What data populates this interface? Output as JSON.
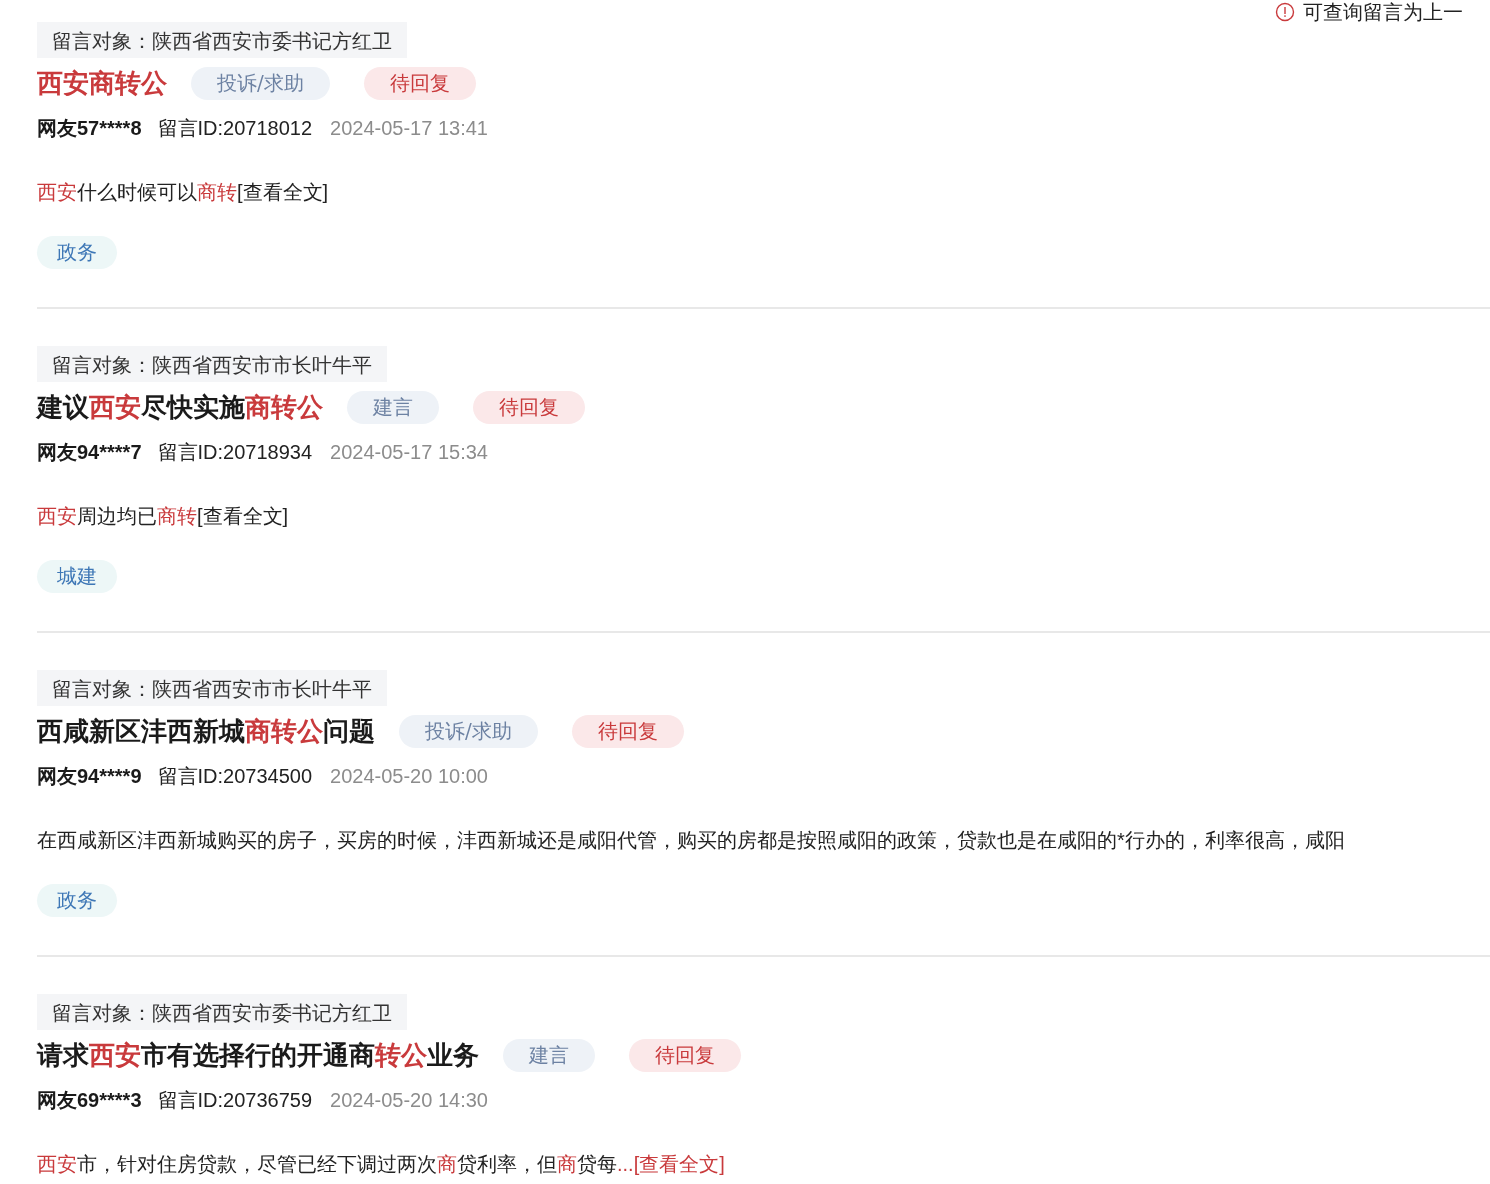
{
  "notice": {
    "text": "可查询留言为上一"
  },
  "messages": [
    {
      "target": "留言对象：陕西省西安市委书记方红卫",
      "title": [
        {
          "text": "西安商转公",
          "highlight": true
        }
      ],
      "type": "投诉/求助",
      "status": "待回复",
      "author": "网友57****8",
      "message_id": "留言ID:20718012",
      "time": "2024-05-17 13:41",
      "excerpt": [
        {
          "text": "西安",
          "highlight": true
        },
        {
          "text": "什么时候可以",
          "highlight": false
        },
        {
          "text": "商转",
          "highlight": true
        }
      ],
      "more": {
        "text": "[查看全文]",
        "highlight": false
      },
      "tags": [
        "政务"
      ]
    },
    {
      "target": "留言对象：陕西省西安市市长叶牛平",
      "title": [
        {
          "text": "建议",
          "highlight": false
        },
        {
          "text": "西安",
          "highlight": true
        },
        {
          "text": "尽快实施",
          "highlight": false
        },
        {
          "text": "商转公",
          "highlight": true
        }
      ],
      "type": "建言",
      "status": "待回复",
      "author": "网友94****7",
      "message_id": "留言ID:20718934",
      "time": "2024-05-17 15:34",
      "excerpt": [
        {
          "text": "西安",
          "highlight": true
        },
        {
          "text": "周边均已",
          "highlight": false
        },
        {
          "text": "商转",
          "highlight": true
        }
      ],
      "more": {
        "text": "[查看全文]",
        "highlight": false
      },
      "tags": [
        "城建"
      ]
    },
    {
      "target": "留言对象：陕西省西安市市长叶牛平",
      "title": [
        {
          "text": "西咸新区沣西新城",
          "highlight": false
        },
        {
          "text": "商转公",
          "highlight": true
        },
        {
          "text": "问题",
          "highlight": false
        }
      ],
      "type": "投诉/求助",
      "status": "待回复",
      "author": "网友94****9",
      "message_id": "留言ID:20734500",
      "time": "2024-05-20 10:00",
      "excerpt": [
        {
          "text": "在西咸新区沣西新城购买的房子，买房的时候，沣西新城还是咸阳代管，购买的房都是按照咸阳的政策，贷款也是在咸阳的*行办的，利率很高，咸阳",
          "highlight": false
        }
      ],
      "tags": [
        "政务"
      ]
    },
    {
      "target": "留言对象：陕西省西安市委书记方红卫",
      "title": [
        {
          "text": "请求",
          "highlight": false
        },
        {
          "text": "西安",
          "highlight": true
        },
        {
          "text": "市有选择行的开通商",
          "highlight": false
        },
        {
          "text": "转公",
          "highlight": true
        },
        {
          "text": "业务",
          "highlight": false
        }
      ],
      "type": "建言",
      "status": "待回复",
      "author": "网友69****3",
      "message_id": "留言ID:20736759",
      "time": "2024-05-20 14:30",
      "excerpt": [
        {
          "text": "西安",
          "highlight": true
        },
        {
          "text": "市，针对住房贷款，尽管已经下调过两次",
          "highlight": false
        },
        {
          "text": "商",
          "highlight": true
        },
        {
          "text": "贷利率，但",
          "highlight": false
        },
        {
          "text": "商",
          "highlight": true
        },
        {
          "text": "贷每",
          "highlight": false
        }
      ],
      "more": {
        "text": "...[查看全文]",
        "highlight": true
      }
    }
  ]
}
